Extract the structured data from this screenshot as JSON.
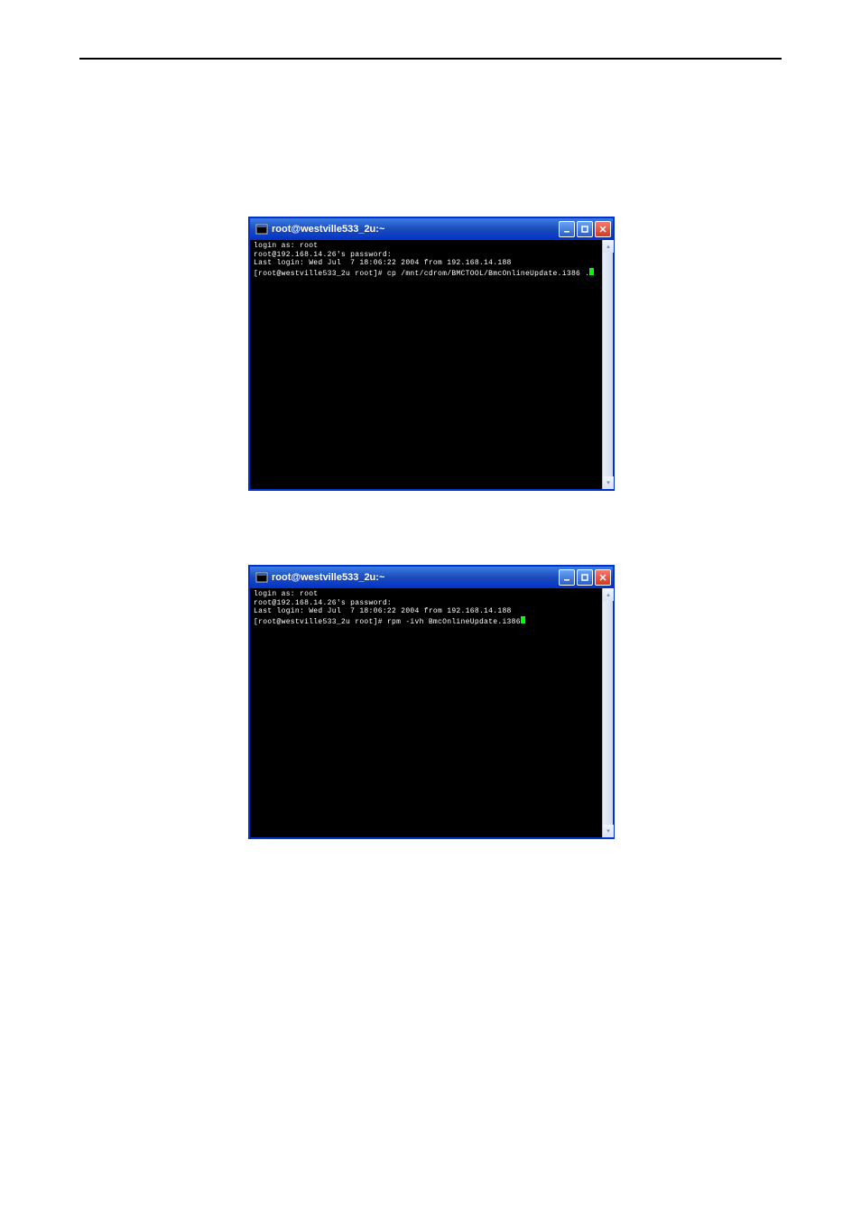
{
  "terminal1": {
    "title": "root@westville533_2u:~",
    "lines": {
      "l1": "login as: root",
      "l2": "root@192.168.14.26's password:",
      "l3": "Last login: Wed Jul  7 18:06:22 2004 from 192.168.14.188",
      "l4": "[root@westville533_2u root]# cp /mnt/cdrom/BMCTOOL/BmcOnlineUpdate.i386 ."
    }
  },
  "terminal2": {
    "title": "root@westville533_2u:~",
    "lines": {
      "l1": "login as: root",
      "l2": "root@192.168.14.26's password:",
      "l3": "Last login: Wed Jul  7 18:06:22 2004 from 192.168.14.188",
      "l4": "[root@westville533_2u root]# rpm -ivh BmcOnlineUpdate.i386"
    }
  },
  "controls": {
    "minimize": "_",
    "maximize": "□",
    "close": "×",
    "up": "▴",
    "down": "▾"
  }
}
